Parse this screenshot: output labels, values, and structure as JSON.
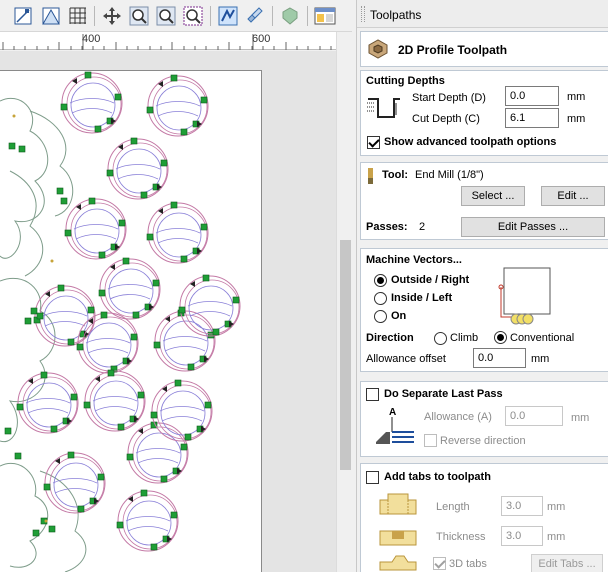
{
  "toolbar": {
    "icons": [
      "snap-icon",
      "grid-snap-icon",
      "grid-icon",
      "move-icon",
      "zoom-icon",
      "zoom-fit-icon",
      "zoom-selection-icon",
      "toolpath-preview-icon",
      "layers-icon",
      "material-icon",
      "window-layout-icon"
    ]
  },
  "ruler": {
    "labels": [
      "400",
      "600"
    ]
  },
  "panel": {
    "title": "Toolpaths",
    "toolpath_name": "2D Profile Toolpath",
    "cutting_depths": {
      "heading": "Cutting Depths",
      "start_label": "Start Depth (D)",
      "start_value": "0.0",
      "cut_label": "Cut Depth (C)",
      "cut_value": "6.1",
      "unit": "mm",
      "advanced_label": "Show advanced toolpath options",
      "advanced_checked": true
    },
    "tool": {
      "label": "Tool:",
      "name": "End Mill (1/8\")",
      "select_btn": "Select ...",
      "edit_btn": "Edit ...",
      "passes_label": "Passes:",
      "passes_value": "2",
      "edit_passes_btn": "Edit Passes ..."
    },
    "machine_vectors": {
      "heading": "Machine Vectors...",
      "options": [
        "Outside / Right",
        "Inside / Left",
        "On"
      ],
      "selected": "Outside / Right",
      "direction_label": "Direction",
      "climb": "Climb",
      "conventional": "Conventional",
      "direction_selected": "Conventional",
      "allowance_label": "Allowance offset",
      "allowance_value": "0.0",
      "unit": "mm"
    },
    "last_pass": {
      "heading": "Do Separate Last Pass",
      "allowance_label": "Allowance (A)",
      "allowance_value": "0.0",
      "unit": "mm",
      "reverse_label": "Reverse direction"
    },
    "tabs": {
      "heading": "Add tabs to toolpath",
      "length_label": "Length",
      "length_value": "3.0",
      "thickness_label": "Thickness",
      "thickness_value": "3.0",
      "unit": "mm",
      "tabs3d_label": "3D tabs",
      "edit_tabs_btn": "Edit Tabs ..."
    }
  }
}
